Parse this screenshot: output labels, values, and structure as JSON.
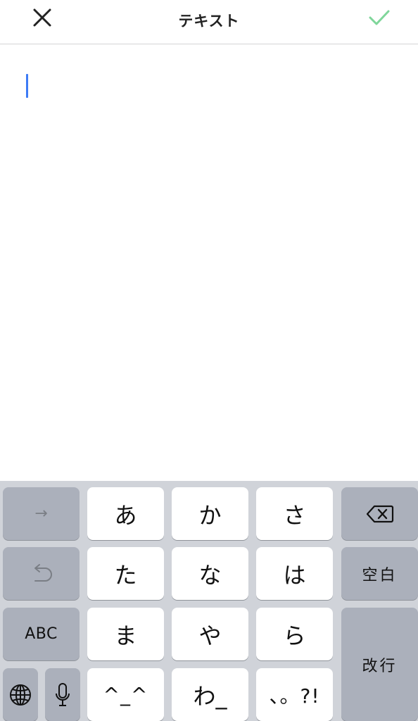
{
  "header": {
    "title": "テキスト",
    "close_icon": "close-icon",
    "done_icon": "checkmark-icon",
    "done_color": "#7fd69a"
  },
  "editor": {
    "value": "",
    "caret_color": "#3d7bf5"
  },
  "keyboard": {
    "rows": [
      [
        "→",
        "あ",
        "か",
        "さ",
        "⌫"
      ],
      [
        "↺",
        "た",
        "な",
        "は",
        "空白"
      ],
      [
        "ABC",
        "ま",
        "や",
        "ら",
        "改行"
      ],
      [
        "🌐",
        "🎤",
        "^_^",
        "わ_",
        "、。?!"
      ]
    ],
    "keys": {
      "next": "→",
      "a": "あ",
      "ka": "か",
      "sa": "さ",
      "backspace_icon": "backspace-icon",
      "undo_icon": "undo-icon",
      "ta": "た",
      "na": "な",
      "ha": "は",
      "space": "空白",
      "abc": "ABC",
      "ma": "ま",
      "ya": "や",
      "ra": "ら",
      "return": "改行",
      "globe_icon": "globe-icon",
      "mic_icon": "microphone-icon",
      "kaomoji": "^_^",
      "wa": "わ_",
      "punct": "、。?!"
    }
  }
}
